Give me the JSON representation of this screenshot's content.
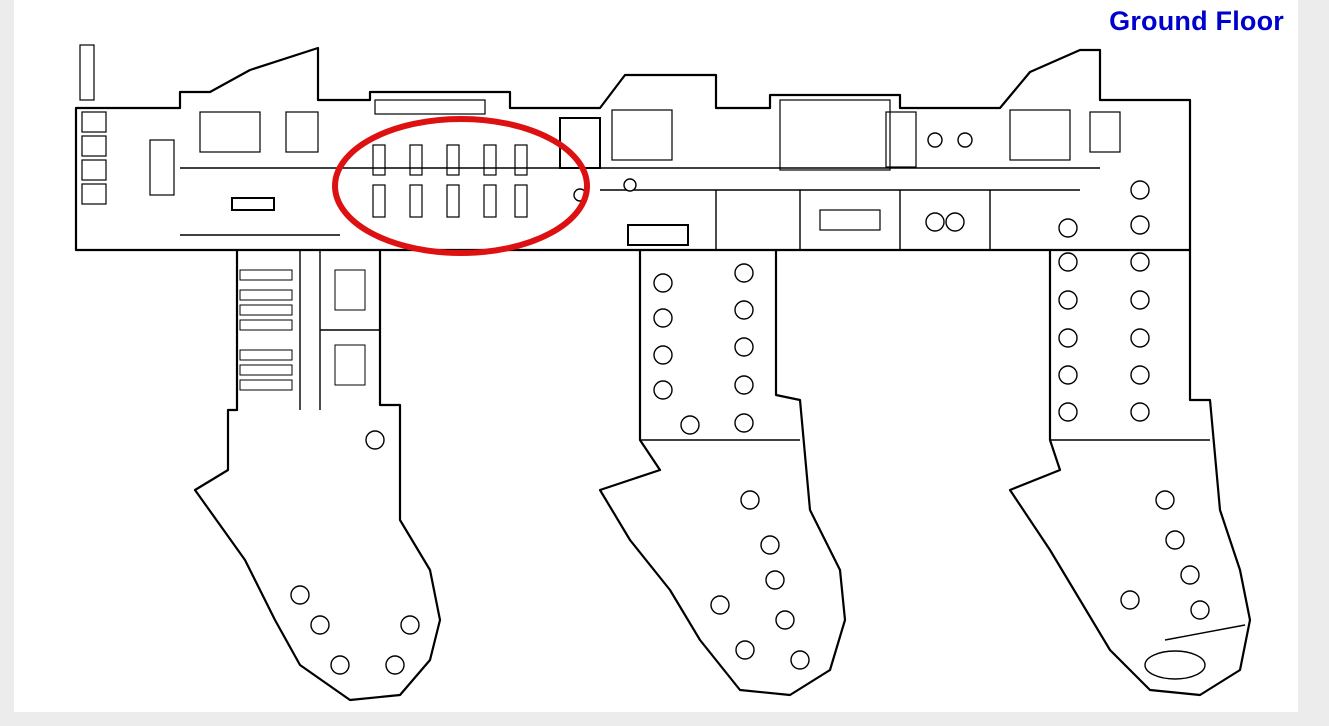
{
  "floor_plan": {
    "title": "Ground Floor",
    "title_color": "#0000cc",
    "wall_color": "#000000",
    "highlight_color": "#dd1111",
    "highlight_target": "bookshelf-stack-area"
  }
}
